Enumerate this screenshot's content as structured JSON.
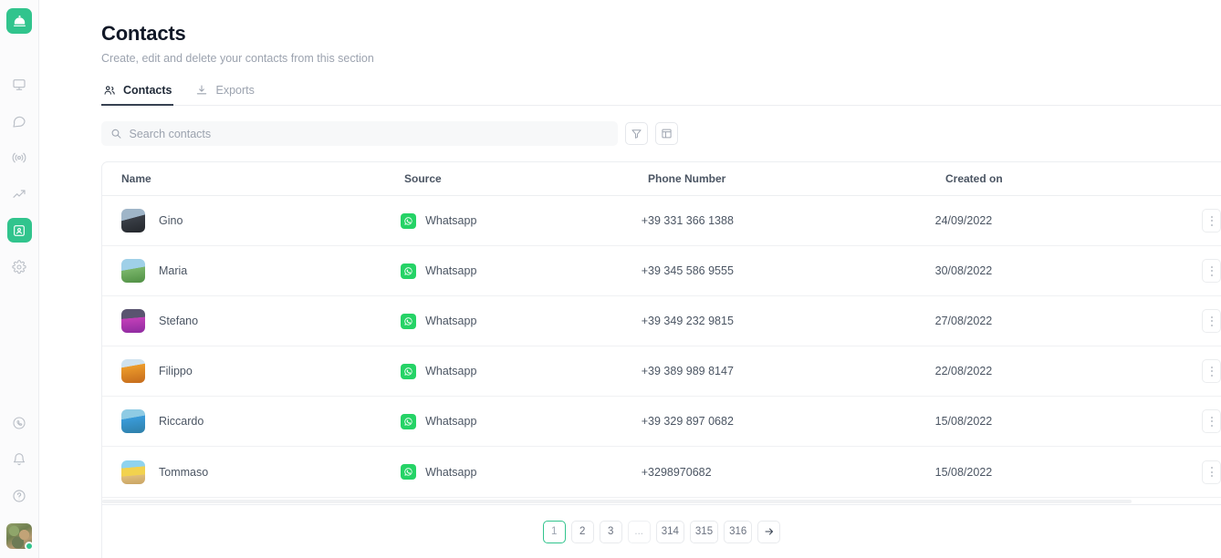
{
  "brand": {
    "logo_icon": "dome-logo-icon",
    "accent": "#31c48d"
  },
  "sidebar": {
    "top_items": [
      {
        "icon": "monitor-icon",
        "name": "dashboard",
        "active": false
      },
      {
        "icon": "chat-bubble-icon",
        "name": "chat",
        "active": false
      },
      {
        "icon": "broadcast-icon",
        "name": "broadcast",
        "active": false
      },
      {
        "icon": "trending-up-icon",
        "name": "analytics",
        "active": false
      },
      {
        "icon": "contact-card-icon",
        "name": "contacts",
        "active": true
      },
      {
        "icon": "gear-icon",
        "name": "settings",
        "active": false
      }
    ],
    "bottom_items": [
      {
        "icon": "whatsapp-icon",
        "name": "whatsapp"
      },
      {
        "icon": "bell-icon",
        "name": "notifications"
      },
      {
        "icon": "help-circle-icon",
        "name": "help"
      }
    ],
    "avatar": {
      "name": "user-avatar",
      "status": "online"
    }
  },
  "header": {
    "title": "Contacts",
    "subtitle": "Create, edit and delete your contacts from this section"
  },
  "tabs": [
    {
      "label": "Contacts",
      "icon": "people-icon",
      "active": true
    },
    {
      "label": "Exports",
      "icon": "download-icon",
      "active": false
    }
  ],
  "search": {
    "placeholder": "Search contacts",
    "value": "",
    "icon": "search-icon"
  },
  "toolbar_buttons": [
    {
      "name": "filter-button",
      "icon": "funnel-icon"
    },
    {
      "name": "columns-button",
      "icon": "table-columns-icon"
    }
  ],
  "table": {
    "columns": [
      "Name",
      "Source",
      "Phone Number",
      "Created on"
    ],
    "rows": [
      {
        "name": "Gino",
        "source": "Whatsapp",
        "phone": "+39 331 366 1388",
        "created": "24/09/2022",
        "avatar": "av1"
      },
      {
        "name": "Maria",
        "source": "Whatsapp",
        "phone": "+39 345 586 9555",
        "created": "30/08/2022",
        "avatar": "av2"
      },
      {
        "name": "Stefano",
        "source": "Whatsapp",
        "phone": "+39 349 232 9815",
        "created": "27/08/2022",
        "avatar": "av3"
      },
      {
        "name": "Filippo",
        "source": "Whatsapp",
        "phone": "+39 389 989 8147",
        "created": "22/08/2022",
        "avatar": "av4"
      },
      {
        "name": "Riccardo",
        "source": "Whatsapp",
        "phone": "+39 329 897 0682",
        "created": "15/08/2022",
        "avatar": "av5"
      },
      {
        "name": "Tommaso",
        "source": "Whatsapp",
        "phone": "+3298970682",
        "created": "15/08/2022",
        "avatar": "av6"
      }
    ],
    "row_menu_icon": "kebab-menu-icon"
  },
  "pagination": {
    "pages": [
      "1",
      "2",
      "3",
      "...",
      "314",
      "315",
      "316"
    ],
    "active": "1",
    "next_icon": "arrow-right-icon"
  }
}
